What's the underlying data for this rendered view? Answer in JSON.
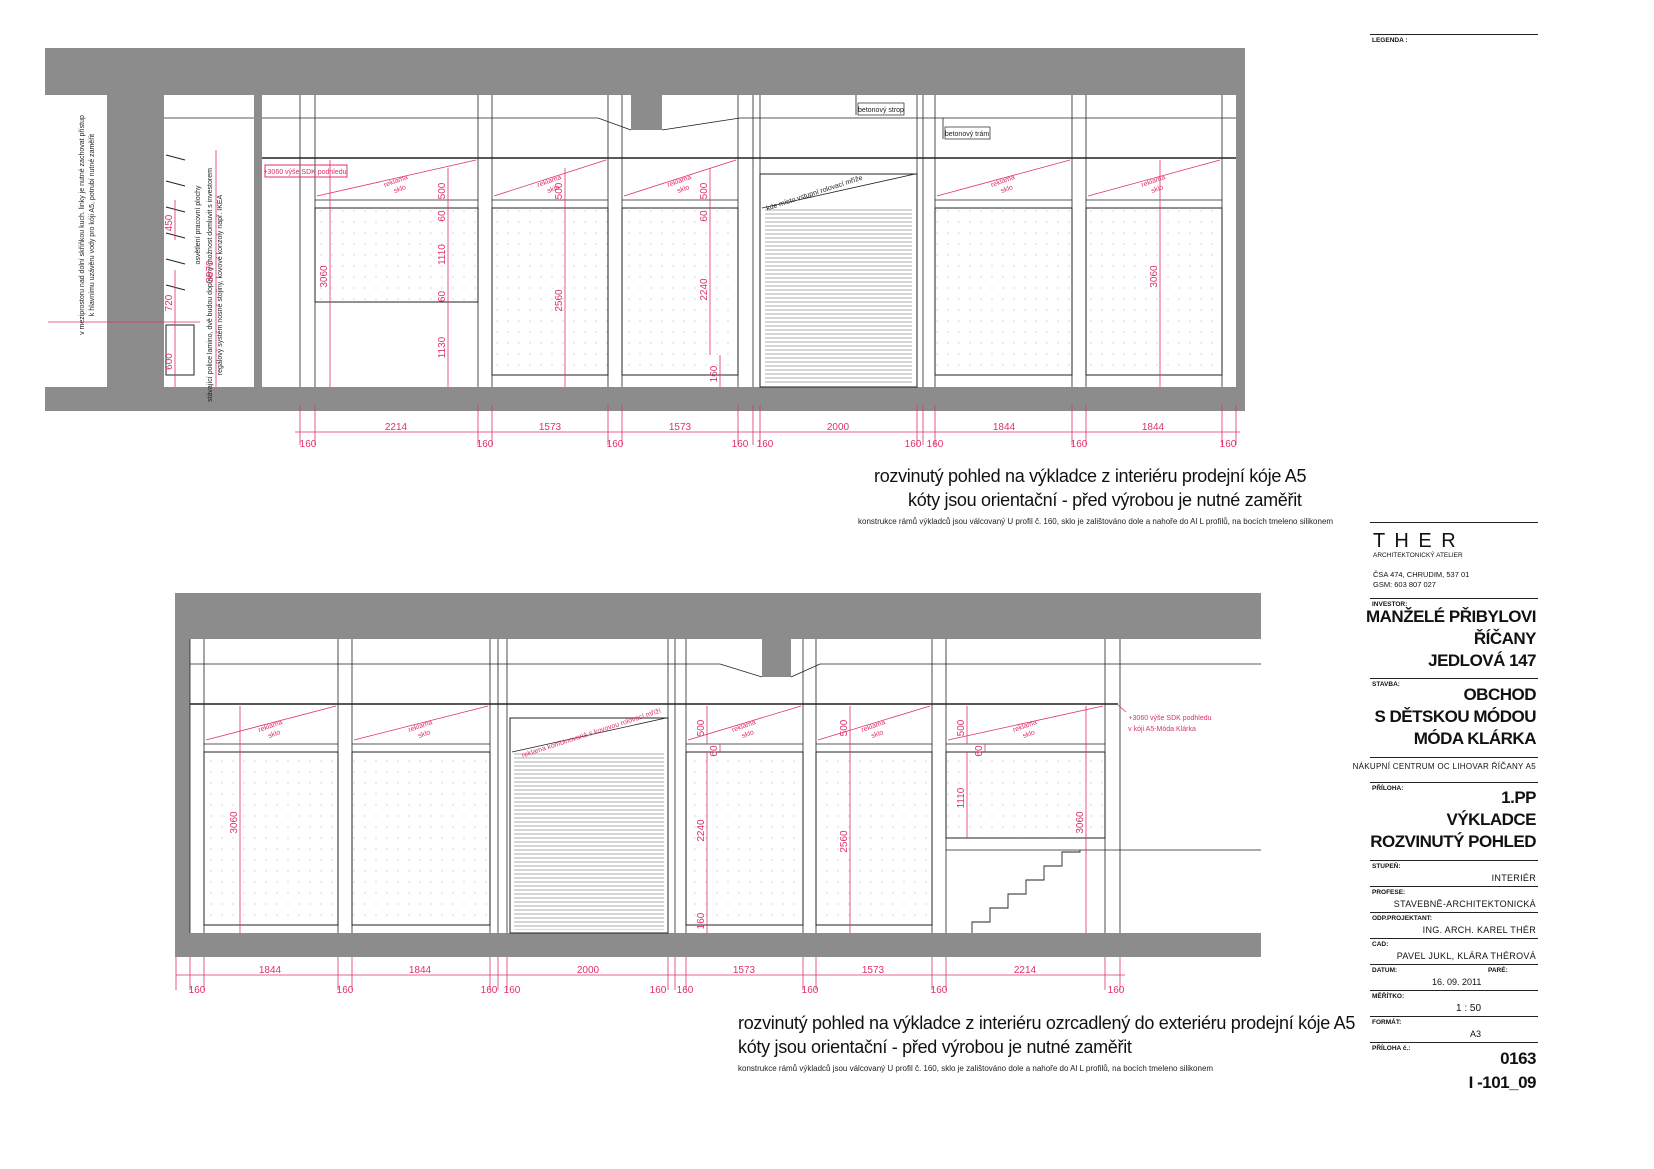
{
  "legend_label": "LEGENDA :",
  "upper": {
    "top_dims": [
      "160",
      "2214",
      "160",
      "1573",
      "1573",
      "160",
      "160",
      "2000",
      "160",
      "160",
      "1844",
      "160",
      "1844",
      "160"
    ],
    "heights": [
      "500",
      "60",
      "1110",
      "60",
      "1130",
      "3060",
      "3070",
      "720",
      "450",
      "600",
      "500",
      "2560",
      "500",
      "60",
      "2240",
      "160",
      "3060"
    ],
    "labels": {
      "strop": "betonový strop",
      "tram": "betonový trám",
      "sdk": "+3060 výše SDK podhledu",
      "reklama": "reklama sklo",
      "rolovaci": "kde místo vstupní rolovací mříže",
      "left_note1": "v meziprostoru nad dolní skříňkou kuch. linky je nutné zachovat přístup",
      "left_note2": "k hlavnímu uzávěru vody pro kóji A5, potrubí nutné zaměřit",
      "left_note3": "stávající police lamino, dvě budou doplněny-možnost domluvit s investorem",
      "left_note4": "regálový systém nosné stojiny, kovové konzoly např. IKEA",
      "left_note5": "osvětlení pracovní plochy"
    },
    "caption1": "rozvinutý pohled na výkladce z interiéru prodejní kóje A5",
    "caption2": "kóty jsou orientační - před výrobou je nutné zaměřit",
    "caption3": "konstrukce rámů výkladců jsou válcovaný U profil č. 160, sklo je zalištováno dole a nahoře do Al L profilů, na bocích tmeleno silikonem"
  },
  "lower": {
    "dims": [
      "160",
      "1844",
      "160",
      "1844",
      "160",
      "160",
      "2000",
      "160",
      "160",
      "1573",
      "1573",
      "160",
      "2214",
      "160"
    ],
    "heights": [
      "3060",
      "500",
      "60",
      "2240",
      "160",
      "500",
      "2560",
      "500",
      "60",
      "1110",
      "3060"
    ],
    "labels": {
      "sdk": "+3060 výše SDK podhledu",
      "sdk2": "v kóji A5-Móda Klárka",
      "reklama": "reklama sklo",
      "rolovaci": "reklama kombinovaná s kovovou rolovací mříží"
    },
    "caption1": "rozvinutý pohled na výkladce z interiéru ozrcadlený do exteriéru prodejní kóje A5",
    "caption2": "kóty jsou orientační - před výrobou je nutné zaměřit",
    "caption3": "konstrukce rámů výkladců jsou válcovaný U profil č. 160, sklo je zalištováno dole a nahoře do Al L profilů, na bocích tmeleno silikonem"
  },
  "titleblock": {
    "firm": "T H E R",
    "firm_sub": "ARCHITEKTONICKÝ ATELIER",
    "address": "ČSA 474, CHRUDIM, 537 01",
    "gsm": "GSM:   603 807 027",
    "investor_label": "INVESTOR:",
    "investor": [
      "MANŽELÉ PŘIBYLOVI",
      "ŘÍČANY",
      "JEDLOVÁ 147"
    ],
    "stavba_label": "STAVBA:",
    "stavba": [
      "OBCHOD",
      "S DĚTSKOU  MÓDOU",
      "MÓDA KLÁRKA"
    ],
    "location": "NÁKUPNÍ CENTRUM OC LIHOVAR ŘÍČANY A5",
    "priloha_label": "PŘÍLOHA:",
    "priloha": [
      "1.PP",
      "VÝKLADCE",
      "ROZVINUTÝ POHLED"
    ],
    "stupen_label": "STUPEŇ:",
    "stupen": "INTERIÉR",
    "profese_label": "PROFESE:",
    "profese": "STAVEBNĚ-ARCHITEKTONICKÁ",
    "odp_label": "ODP.PROJEKTANT:",
    "odp": "ING. ARCH. KAREL THÉR",
    "cad_label": "CAD:",
    "cad": "PAVEL JUKL, KLÁRA THÉROVÁ",
    "datum_label": "DATUM:",
    "datum": "16. 09. 2011",
    "pare_label": "PARÉ:",
    "meritko_label": "MĚŘÍTKO:",
    "meritko": "1 : 50",
    "format_label": "FORMÁT:",
    "format": "A3",
    "priloha_c_label": "PŘÍLOHA č.:",
    "priloha_c": "0163",
    "sheet": "I -101_09"
  },
  "colors": {
    "dim": "#e0306a",
    "wall": "#8c8c8c",
    "line": "#222222"
  }
}
